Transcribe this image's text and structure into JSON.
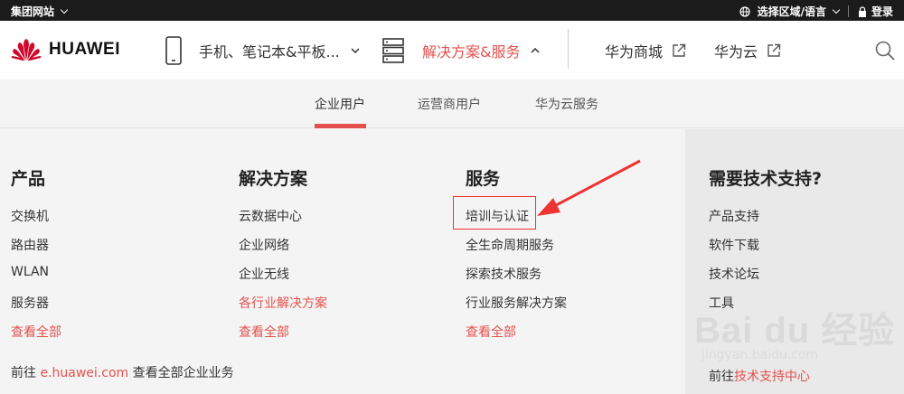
{
  "topbar": {
    "group_label": "集团网站",
    "region_label": "选择区域/语言",
    "login_label": "登录"
  },
  "navbar": {
    "brand": "HUAWEI",
    "devices_label": "手机、笔记本&平板...",
    "solutions_label": "解决方案&服务",
    "mall_label": "华为商城",
    "cloud_label": "华为云"
  },
  "tabs": [
    {
      "label": "企业用户"
    },
    {
      "label": "运营商用户"
    },
    {
      "label": "华为云服务"
    }
  ],
  "columns": {
    "products": {
      "title": "产品",
      "items": [
        "交换机",
        "路由器",
        "WLAN",
        "服务器"
      ],
      "more": "查看全部"
    },
    "solutions": {
      "title": "解决方案",
      "items": [
        "云数据中心",
        "企业网络",
        "企业无线",
        "各行业解决方案"
      ],
      "more": "查看全部"
    },
    "services": {
      "title": "服务",
      "items": [
        "培训与认证",
        "全生命周期服务",
        "探索技术服务",
        "行业服务解决方案"
      ],
      "more": "查看全部"
    },
    "support": {
      "title": "需要技术支持?",
      "items": [
        "产品支持",
        "软件下载",
        "技术论坛",
        "工具"
      ]
    }
  },
  "footer": {
    "prefix": "前往",
    "link": "e.huawei.com",
    "suffix": "查看全部企业业务"
  },
  "side_footer": {
    "prefix": "前往",
    "link": "技术支持中心"
  },
  "watermark": {
    "text": "Bai du 经验",
    "subtext": "jingyan.baidu.com"
  },
  "colors": {
    "accent": "#e4514d",
    "topbar": "#1b1b1b"
  }
}
